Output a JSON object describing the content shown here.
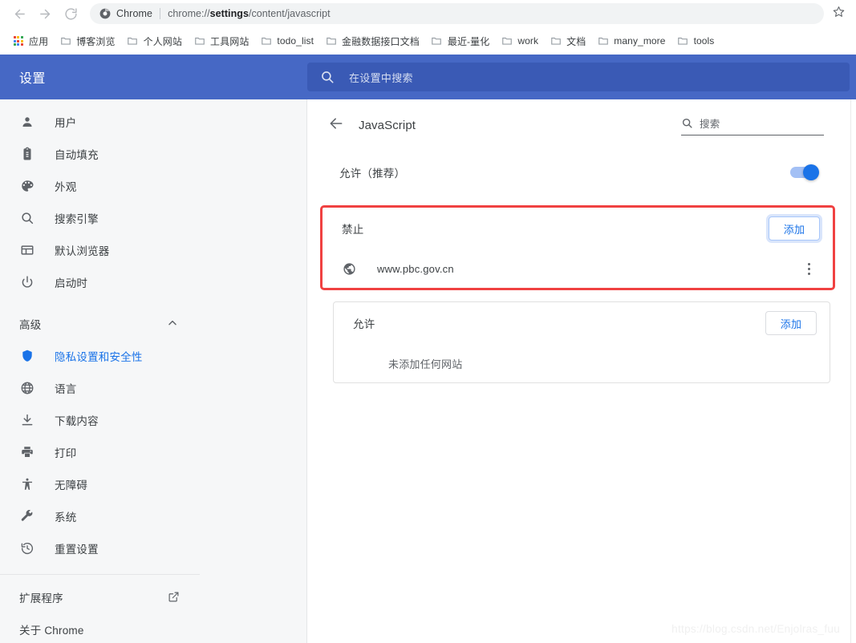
{
  "browser": {
    "nav": {
      "back_icon": "arrow-back-icon",
      "forward_icon": "arrow-forward-icon",
      "reload_icon": "reload-icon",
      "star_icon": "star-icon"
    },
    "omnibox": {
      "chip_icon": "chrome-logo-icon",
      "chip_label": "Chrome",
      "url_prefix": "chrome://",
      "url_bold": "settings",
      "url_suffix": "/content/javascript",
      "full_url": "chrome://settings/content/javascript"
    },
    "bookmarks": [
      {
        "label": "应用",
        "icon": "apps-grid-icon"
      },
      {
        "label": "博客浏览",
        "icon": "folder-icon"
      },
      {
        "label": "个人网站",
        "icon": "folder-icon"
      },
      {
        "label": "工具网站",
        "icon": "folder-icon"
      },
      {
        "label": "todo_list",
        "icon": "folder-icon"
      },
      {
        "label": "金融数据接口文档",
        "icon": "folder-icon"
      },
      {
        "label": "最近-量化",
        "icon": "folder-icon"
      },
      {
        "label": "work",
        "icon": "folder-icon"
      },
      {
        "label": "文档",
        "icon": "folder-icon"
      },
      {
        "label": "many_more",
        "icon": "folder-icon"
      },
      {
        "label": "tools",
        "icon": "folder-icon"
      }
    ]
  },
  "settings_header": {
    "title": "设置",
    "search_icon": "search-icon",
    "search_placeholder": "在设置中搜索",
    "background_color": "#4668c5"
  },
  "sidebar": {
    "items": [
      {
        "label": "用户",
        "icon": "person-icon",
        "selected": false
      },
      {
        "label": "自动填充",
        "icon": "clipboard-icon",
        "selected": false
      },
      {
        "label": "外观",
        "icon": "palette-icon",
        "selected": false
      },
      {
        "label": "搜索引擎",
        "icon": "search-icon",
        "selected": false
      },
      {
        "label": "默认浏览器",
        "icon": "browser-window-icon",
        "selected": false
      },
      {
        "label": "启动时",
        "icon": "power-icon",
        "selected": false
      }
    ],
    "advanced": {
      "label": "高级",
      "caret_icon": "chevron-up-icon",
      "expanded": true,
      "items": [
        {
          "label": "隐私设置和安全性",
          "icon": "shield-icon",
          "selected": true
        },
        {
          "label": "语言",
          "icon": "globe-icon",
          "selected": false
        },
        {
          "label": "下载内容",
          "icon": "download-icon",
          "selected": false
        },
        {
          "label": "打印",
          "icon": "printer-icon",
          "selected": false
        },
        {
          "label": "无障碍",
          "icon": "accessibility-icon",
          "selected": false
        },
        {
          "label": "系统",
          "icon": "wrench-icon",
          "selected": false
        },
        {
          "label": "重置设置",
          "icon": "history-restore-icon",
          "selected": false
        }
      ]
    },
    "footer": [
      {
        "label": "扩展程序",
        "trailing_icon": "external-link-icon"
      },
      {
        "label": "关于 Chrome",
        "trailing_icon": null
      }
    ],
    "selected_accent_color": "#1a73e8"
  },
  "main": {
    "back_icon": "arrow-back-icon",
    "title": "JavaScript",
    "search": {
      "icon": "search-icon",
      "placeholder": "搜索",
      "value": ""
    },
    "toggle": {
      "label": "允许（推荐）",
      "state": "on",
      "on_color": "#1a73e8"
    },
    "sections": [
      {
        "id": "block",
        "label": "禁止",
        "add_button": "添加",
        "add_button_focused": true,
        "highlighted": true,
        "highlight_color": "#f04141",
        "sites": [
          {
            "url": "www.pbc.gov.cn",
            "favicon": "globe-icon",
            "menu_icon": "more-vertical-icon"
          }
        ],
        "empty_text": null
      },
      {
        "id": "allow",
        "label": "允许",
        "add_button": "添加",
        "add_button_focused": false,
        "highlighted": false,
        "sites": [],
        "empty_text": "未添加任何网站"
      }
    ],
    "watermark": "https://blog.csdn.net/Enjolras_fuu"
  }
}
